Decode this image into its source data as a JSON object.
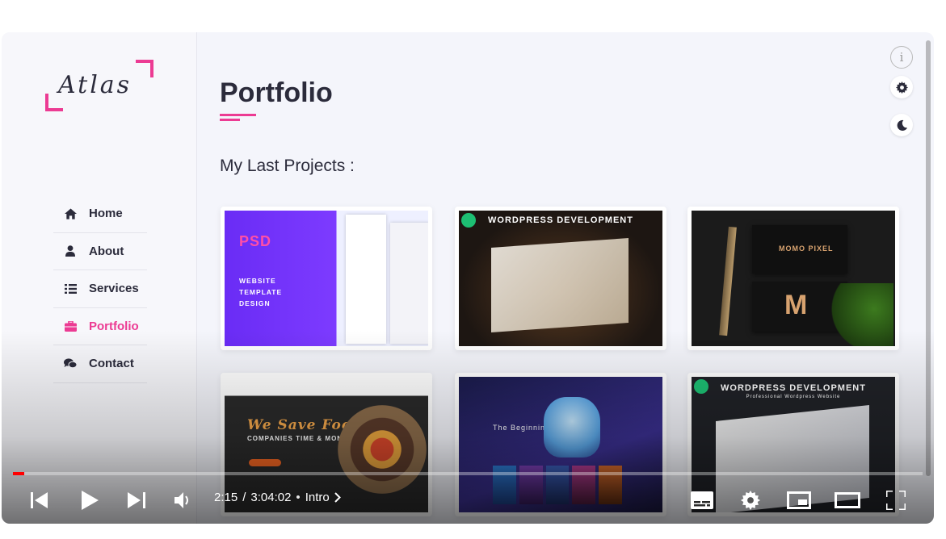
{
  "logo": {
    "text": "Atlas"
  },
  "sidebar": {
    "items": [
      {
        "label": "Home",
        "icon": "home-icon",
        "active": false
      },
      {
        "label": "About",
        "icon": "user-icon",
        "active": false
      },
      {
        "label": "Services",
        "icon": "list-icon",
        "active": false
      },
      {
        "label": "Portfolio",
        "icon": "briefcase-icon",
        "active": true
      },
      {
        "label": "Contact",
        "icon": "comments-icon",
        "active": false
      }
    ]
  },
  "main": {
    "title": "Portfolio",
    "section_title": "My Last Projects :",
    "projects": [
      {
        "caption": "PSD",
        "subtitle": "WEBSITE TEMPLATE DESIGN"
      },
      {
        "caption": "WORDPRESS DEVELOPMENT"
      },
      {
        "caption": "MOMO PIXEL"
      },
      {
        "caption": "We Save Food",
        "subtitle": "COMPANIES TIME & MONEY"
      },
      {
        "caption": "The Beginning"
      },
      {
        "caption": "WORDPRESS DEVELOPMENT",
        "subtitle": "Professional Wordpress Website"
      }
    ]
  },
  "player": {
    "current_time": "2:15",
    "duration": "3:04:02",
    "chapter": "Intro",
    "progress": 0.012,
    "accent": "#ff0000"
  },
  "theme": {
    "accent": "#ec3b93",
    "text": "#2b2b3b"
  }
}
